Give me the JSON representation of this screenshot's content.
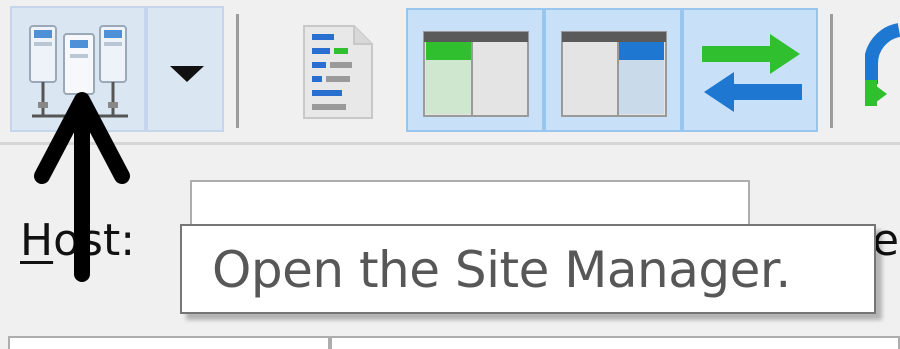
{
  "toolbar": {
    "buttons": [
      {
        "name": "site-manager",
        "state": "hover"
      },
      {
        "name": "site-manager-dropdown",
        "state": "hover"
      },
      {
        "name": "toggle-message-log",
        "state": "normal"
      },
      {
        "name": "toggle-local-dir-tree",
        "state": "pressed"
      },
      {
        "name": "toggle-remote-dir-tree",
        "state": "pressed"
      },
      {
        "name": "toggle-transfer-queue",
        "state": "pressed"
      }
    ]
  },
  "quickconnect": {
    "host_label_first": "H",
    "host_label_rest": "ost:",
    "host_value": "",
    "next_label_fragment": "e"
  },
  "tooltip": {
    "text": "Open the Site Manager."
  },
  "colors": {
    "accent_green": "#2fbf2f",
    "accent_blue": "#1e78d2",
    "hover_bg": "#dbe6f3",
    "pressed_bg": "#c8e0f8"
  }
}
